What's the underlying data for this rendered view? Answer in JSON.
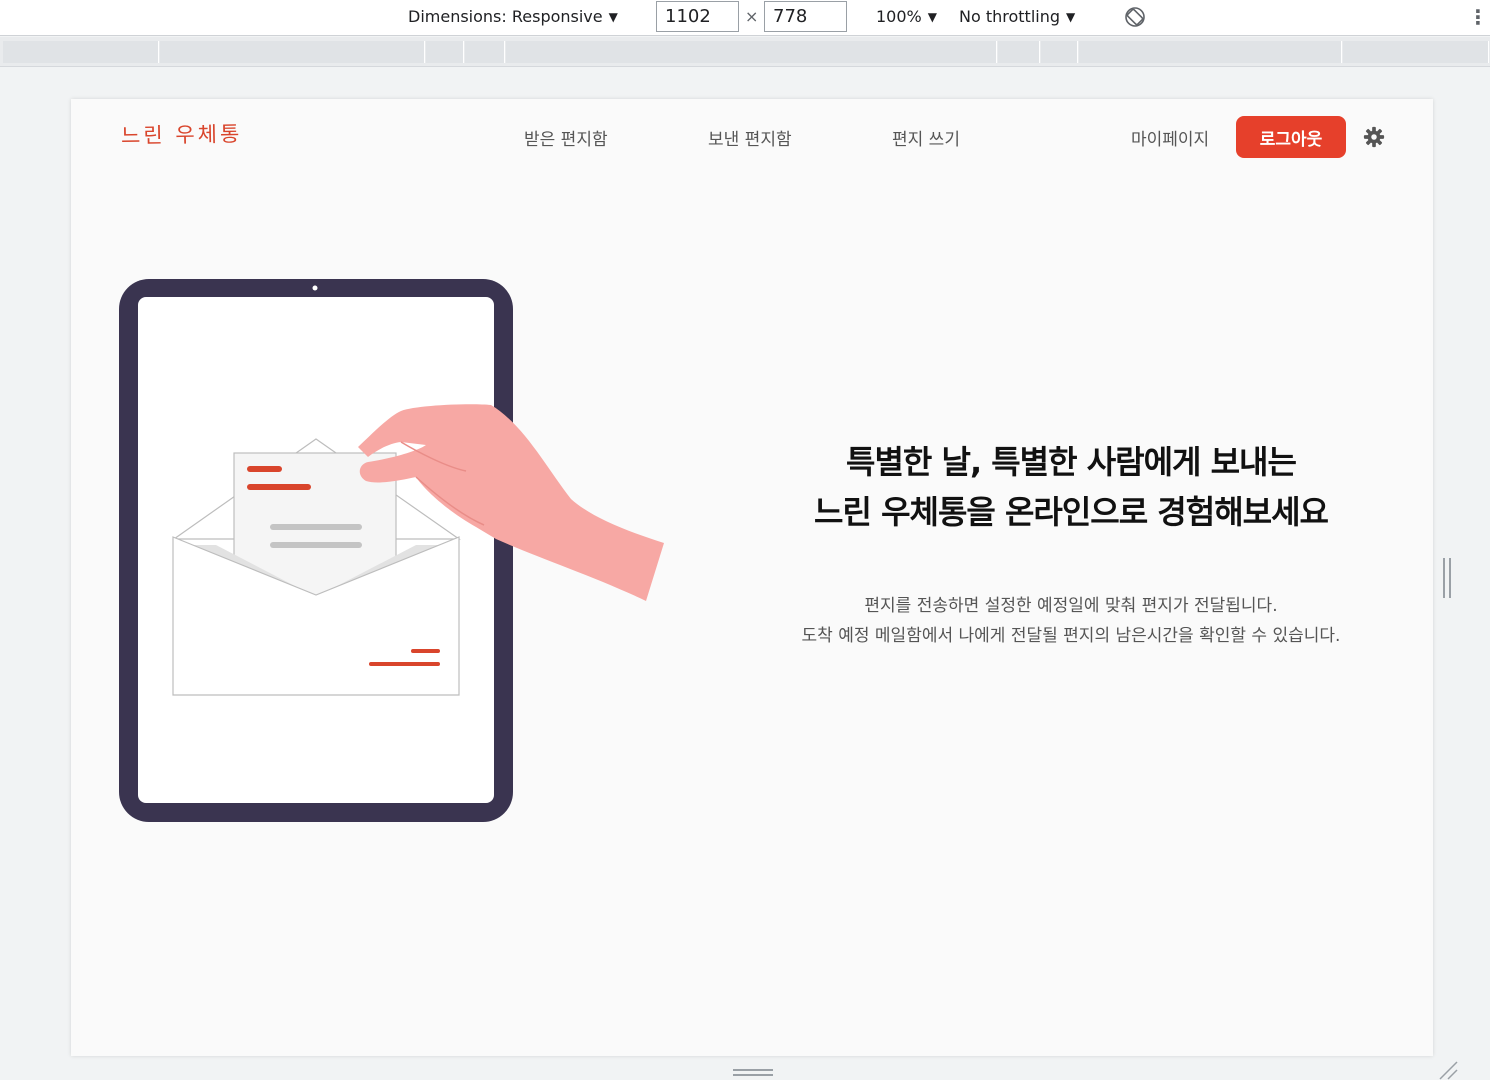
{
  "devtools": {
    "dimensions_label": "Dimensions: Responsive",
    "width_value": "1102",
    "times": "×",
    "height_value": "778",
    "zoom_label": "100%",
    "throttling_label": "No throttling",
    "dropdown_arrow": "▼",
    "more_icon": "⋮"
  },
  "nav": {
    "logo": "느린 우체통",
    "links": [
      "받은 편지함",
      "보낸 편지함",
      "편지 쓰기"
    ],
    "mypage": "마이페이지",
    "logout": "로그아웃"
  },
  "hero": {
    "title_line1": "특별한 날, 특별한 사람에게 보내는",
    "title_line2": "느린 우체통을 온라인으로 경험해보세요",
    "desc_line1": "편지를 전송하면 설정한 예정일에 맞춰 편지가 전달됩니다.",
    "desc_line2": "도착 예정 메일함에서 나에게 전달될 편지의 남은시간을 확인할 수 있습니다."
  },
  "colors": {
    "accent": "#e6402b",
    "logo": "#d9452c",
    "tablet_frame": "#3a3450",
    "hand": "#f7a8a4"
  }
}
